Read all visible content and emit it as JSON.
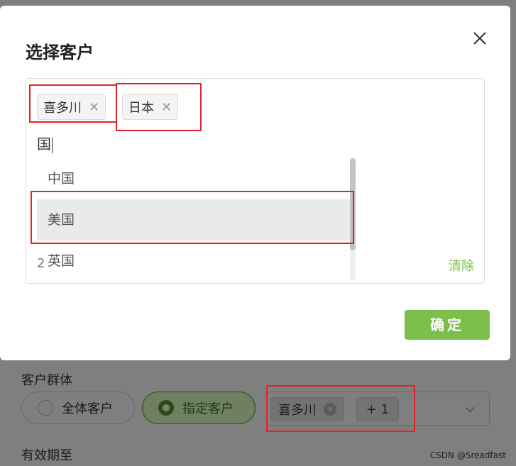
{
  "background": {
    "audience_label": "客户群体",
    "radio_all": "全体客户",
    "radio_specific": "指定客户",
    "selected_tag": "喜多川",
    "more_tag": "+ 1",
    "validity_label": "有效期至",
    "watermark": "CSDN @Sreadfast"
  },
  "modal": {
    "title": "选择客户",
    "selected_tags": [
      "喜多川",
      "日本"
    ],
    "search_value": "国",
    "options": [
      "中国",
      "美国",
      "英国"
    ],
    "active_option_index": 1,
    "count": "2",
    "clear_label": "清除",
    "confirm_label": "确定"
  },
  "colors": {
    "accent": "#7cc04b",
    "annotation": "#e0242a"
  },
  "icons": {
    "close": "close-icon",
    "tag_remove": "x-icon",
    "dropdown": "chevron-down-icon"
  }
}
